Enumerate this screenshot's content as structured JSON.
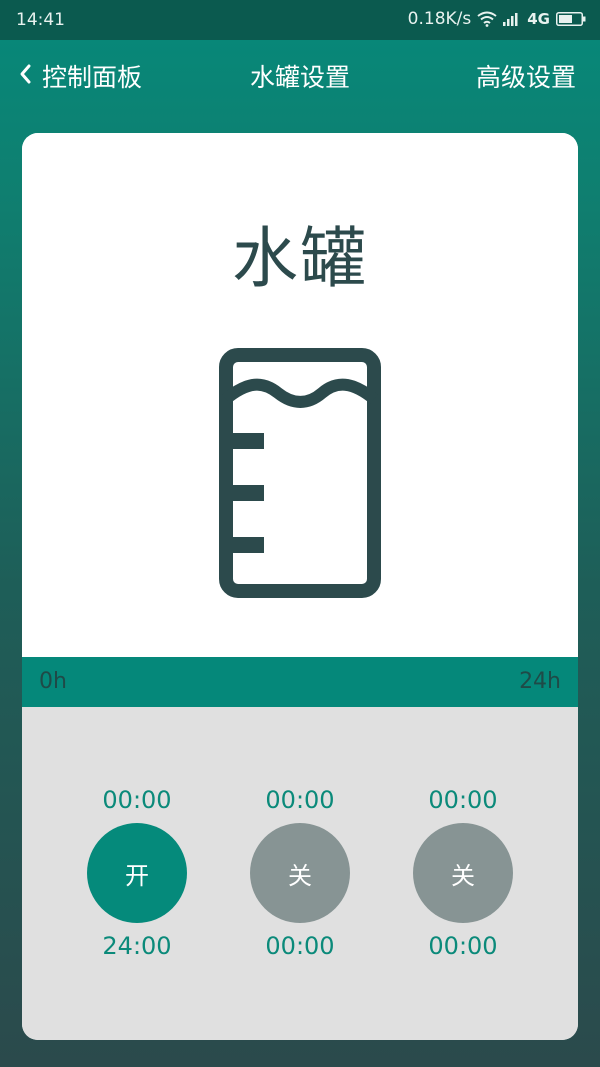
{
  "status_bar": {
    "time": "14:41",
    "net_speed": "0.18K/s",
    "network": "4G",
    "icons": [
      "wifi-icon",
      "signal-icon",
      "battery-icon"
    ]
  },
  "nav": {
    "back_label": "控制面板",
    "title": "水罐设置",
    "right_action": "高级设置"
  },
  "device": {
    "name": "水罐",
    "icon": "water-tank-icon"
  },
  "timeline": {
    "start": "0h",
    "end": "24h"
  },
  "slots": [
    {
      "start": "00:00",
      "state": "开",
      "end": "24:00",
      "active": true
    },
    {
      "start": "00:00",
      "state": "关",
      "end": "00:00",
      "active": false
    },
    {
      "start": "00:00",
      "state": "关",
      "end": "00:00",
      "active": false
    }
  ],
  "colors": {
    "accent": "#058a7b",
    "inactive": "#879494",
    "panel_gray": "#e0e0e0",
    "icon_dark": "#2c4a4c"
  }
}
